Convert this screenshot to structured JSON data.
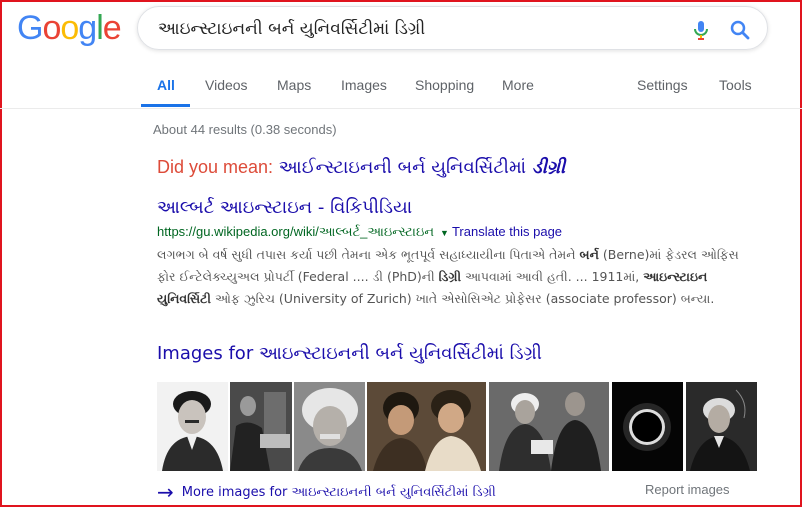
{
  "logo": {
    "letters": [
      "G",
      "o",
      "o",
      "g",
      "l",
      "e"
    ],
    "colors": [
      "#4285f4",
      "#ea4335",
      "#fbbc05",
      "#4285f4",
      "#34a853",
      "#ea4335"
    ]
  },
  "search": {
    "query": "આઇન્સ્ટાઇનની બર્ન યુનિવર્સિટીમાં ડિગ્રી",
    "mic_icon": "microphone-icon",
    "search_icon": "magnifier-icon"
  },
  "tabs": {
    "all": "All",
    "videos": "Videos",
    "maps": "Maps",
    "images": "Images",
    "shopping": "Shopping",
    "more": "More",
    "settings": "Settings",
    "tools": "Tools"
  },
  "stats": "About 44 results (0.38 seconds)",
  "did_you_mean": {
    "label": "Did you mean:",
    "prefix": "આઈન્સ્ટાઇનની બર્ન યુનિવર્સિટીમાં",
    "correction": "ડીગ્રી"
  },
  "result": {
    "title": "આલ્બર્ટ આઇન્સ્ટાઇન - વિકિપીડિયા",
    "url": "https://gu.wikipedia.org/wiki/આલ્બર્ટ_આઇન્સ્ટાઇન",
    "translate": "Translate this page",
    "snippet": {
      "l1a": "લગભગ બે વર્ષ સુધી તપાસ કર્યા પછી તેમના એક ભૂતપૂર્વ સહાધ્યાયીના પિતાએ તેમને ",
      "l1b": "બર્ન",
      "l1c": " (Berne)માં ફેડરલ ઓફિસ",
      "l2a": "ફોર ઈન્ટેલેક્ચ્યુઅલ પ્રોપર્ટી (Federal .... ડી (PhD)ની ",
      "l2b": "ડિગ્રી",
      "l2c": " આપવામાં આવી હતી. ... 1911માં, ",
      "l2d": "આઇન્સ્ટાઇન",
      "l3a": "યુનિવર્સિટી",
      "l3b": " ઓફ ઝુરિચ (University of Zurich) ખાતે એસોસિએટ પ્રોફેસર (associate professor) બન્યા."
    }
  },
  "images": {
    "heading": "Images for આઇન્સ્ટાઇનની બર્ન યુનિવર્સિટીમાં ડિગ્રી",
    "more": "More images for આઇન્સ્ટાઇનની બર્ન યુનિવર્સિટીમાં ડિગ્રી",
    "report": "Report images"
  }
}
